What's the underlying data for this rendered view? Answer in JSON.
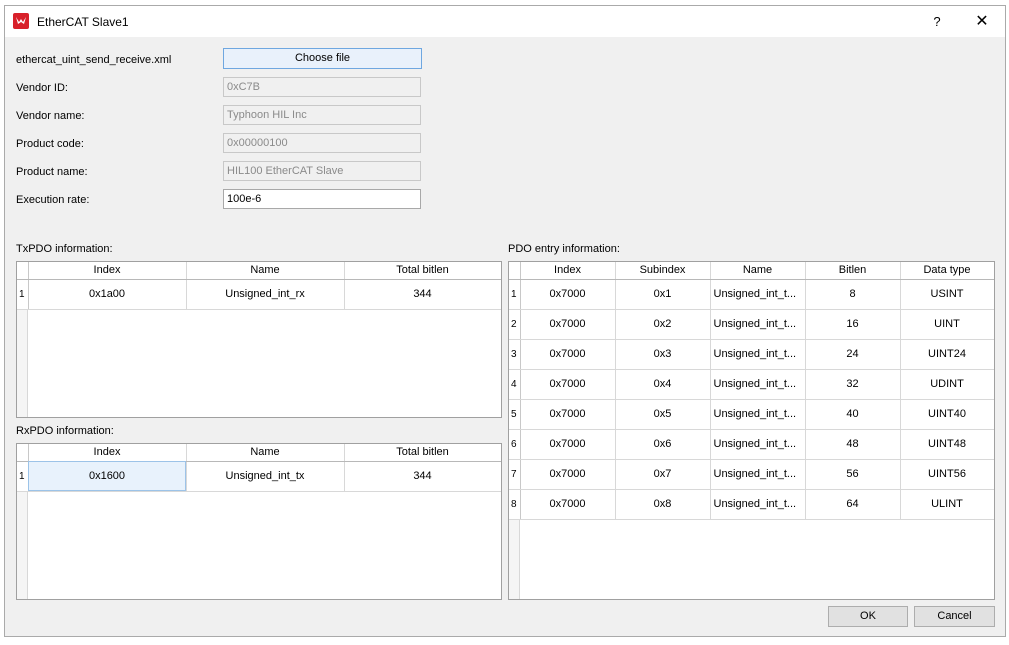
{
  "window": {
    "title": "EtherCAT Slave1",
    "help_label": "?",
    "close_label": "✕"
  },
  "file": {
    "name": "ethercat_uint_send_receive.xml",
    "choose_label": "Choose file"
  },
  "fields": {
    "vendor_id": {
      "label": "Vendor ID:",
      "value": "0xC7B"
    },
    "vendor_name": {
      "label": "Vendor name:",
      "value": "Typhoon HIL Inc"
    },
    "product_code": {
      "label": "Product code:",
      "value": "0x00000100"
    },
    "product_name": {
      "label": "Product name:",
      "value": "HIL100 EtherCAT Slave"
    },
    "execution_rate": {
      "label": "Execution rate:",
      "value": "100e-6"
    }
  },
  "txpdo": {
    "label": "TxPDO information:",
    "headers": [
      "Index",
      "Name",
      "Total bitlen"
    ],
    "rows": [
      {
        "num": "1",
        "index": "0x1a00",
        "name": "Unsigned_int_rx",
        "bitlen": "344"
      }
    ]
  },
  "rxpdo": {
    "label": "RxPDO information:",
    "headers": [
      "Index",
      "Name",
      "Total bitlen"
    ],
    "rows": [
      {
        "num": "1",
        "index": "0x1600",
        "name": "Unsigned_int_tx",
        "bitlen": "344"
      }
    ]
  },
  "pdo_entry": {
    "label": "PDO entry information:",
    "headers": [
      "Index",
      "Subindex",
      "Name",
      "Bitlen",
      "Data type"
    ],
    "rows": [
      {
        "num": "1",
        "index": "0x7000",
        "subindex": "0x1",
        "name": "Unsigned_int_t...",
        "bitlen": "8",
        "type": "USINT"
      },
      {
        "num": "2",
        "index": "0x7000",
        "subindex": "0x2",
        "name": "Unsigned_int_t...",
        "bitlen": "16",
        "type": "UINT"
      },
      {
        "num": "3",
        "index": "0x7000",
        "subindex": "0x3",
        "name": "Unsigned_int_t...",
        "bitlen": "24",
        "type": "UINT24"
      },
      {
        "num": "4",
        "index": "0x7000",
        "subindex": "0x4",
        "name": "Unsigned_int_t...",
        "bitlen": "32",
        "type": "UDINT"
      },
      {
        "num": "5",
        "index": "0x7000",
        "subindex": "0x5",
        "name": "Unsigned_int_t...",
        "bitlen": "40",
        "type": "UINT40"
      },
      {
        "num": "6",
        "index": "0x7000",
        "subindex": "0x6",
        "name": "Unsigned_int_t...",
        "bitlen": "48",
        "type": "UINT48"
      },
      {
        "num": "7",
        "index": "0x7000",
        "subindex": "0x7",
        "name": "Unsigned_int_t...",
        "bitlen": "56",
        "type": "UINT56"
      },
      {
        "num": "8",
        "index": "0x7000",
        "subindex": "0x8",
        "name": "Unsigned_int_t...",
        "bitlen": "64",
        "type": "ULINT"
      }
    ]
  },
  "buttons": {
    "ok": "OK",
    "cancel": "Cancel"
  }
}
